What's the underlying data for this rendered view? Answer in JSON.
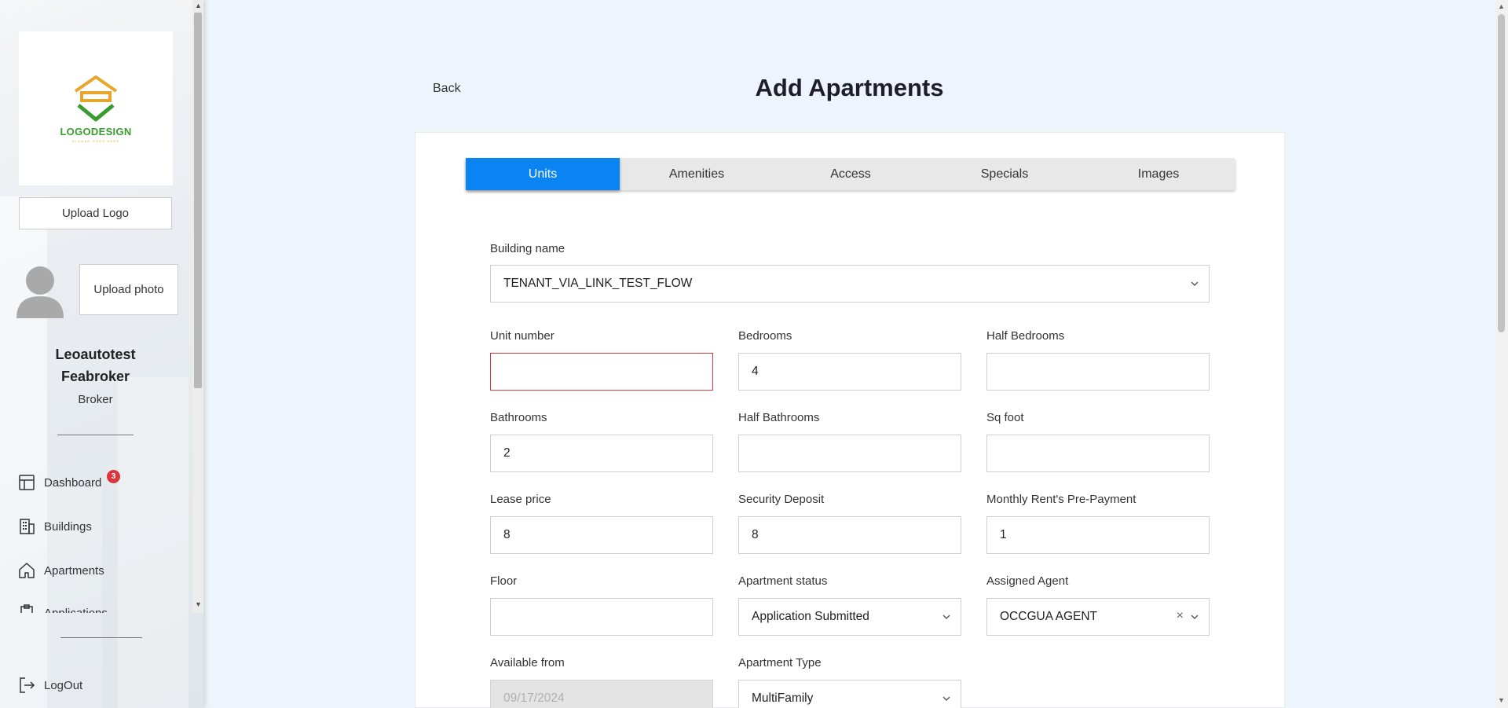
{
  "sidebar": {
    "logo_text": "LOGODESIGN",
    "logo_subtext": "SLOGAN GOES HERE",
    "upload_logo_label": "Upload Logo",
    "upload_photo_label": "Upload photo",
    "user_name": "Leoautotest Feabroker",
    "user_role": "Broker",
    "nav": {
      "dashboard": {
        "label": "Dashboard",
        "badge": "3",
        "icon": "dashboard-icon"
      },
      "buildings": {
        "label": "Buildings",
        "icon": "buildings-icon"
      },
      "apartments": {
        "label": "Apartments",
        "icon": "home-icon"
      },
      "applications": {
        "label": "Applications",
        "icon": "clipboard-icon"
      }
    },
    "logout_label": "LogOut"
  },
  "header": {
    "back_label": "Back",
    "title": "Add Apartments"
  },
  "tabs": [
    {
      "label": "Units",
      "active": true
    },
    {
      "label": "Amenities",
      "active": false
    },
    {
      "label": "Access",
      "active": false
    },
    {
      "label": "Specials",
      "active": false
    },
    {
      "label": "Images",
      "active": false
    }
  ],
  "form": {
    "building_name": {
      "label": "Building name",
      "value": "TENANT_VIA_LINK_TEST_FLOW"
    },
    "unit_number": {
      "label": "Unit number",
      "value": ""
    },
    "bedrooms": {
      "label": "Bedrooms",
      "value": "4"
    },
    "half_bedrooms": {
      "label": "Half Bedrooms",
      "value": ""
    },
    "bathrooms": {
      "label": "Bathrooms",
      "value": "2"
    },
    "half_bathrooms": {
      "label": "Half Bathrooms",
      "value": ""
    },
    "sq_foot": {
      "label": "Sq foot",
      "value": ""
    },
    "lease_price": {
      "label": "Lease price",
      "value": "8"
    },
    "security_deposit": {
      "label": "Security Deposit",
      "value": "8"
    },
    "monthly_prepayment": {
      "label": "Monthly Rent's Pre-Payment",
      "value": "1"
    },
    "floor": {
      "label": "Floor",
      "value": ""
    },
    "apartment_status": {
      "label": "Apartment status",
      "value": "Application Submitted"
    },
    "assigned_agent": {
      "label": "Assigned Agent",
      "value": "OCCGUA AGENT"
    },
    "available_from": {
      "label": "Available from",
      "value": "09/17/2024"
    },
    "apartment_type": {
      "label": "Apartment Type",
      "value": "MultiFamily"
    }
  },
  "colors": {
    "accent": "#0b84f3",
    "error": "#d9363e",
    "background": "#eef4fb"
  }
}
